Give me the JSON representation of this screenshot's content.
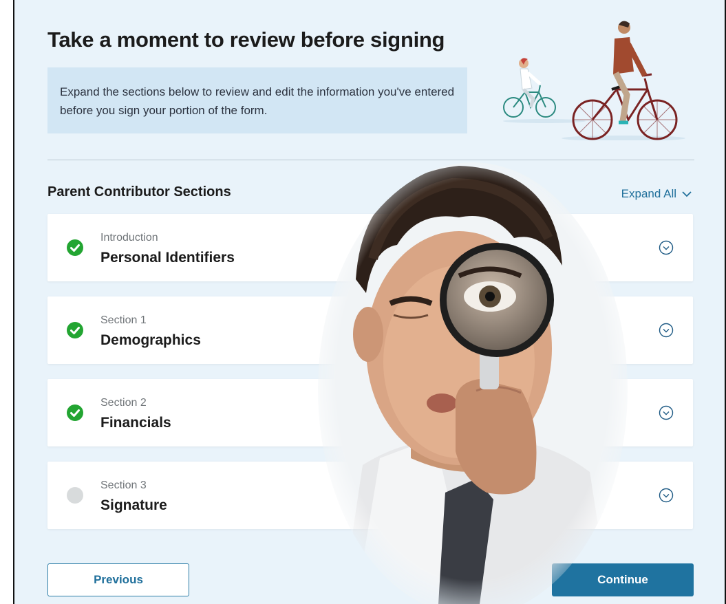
{
  "page": {
    "title": "Take a moment to review before signing",
    "info": "Expand the sections below to review and edit the information you've entered before you sign your portion of the form."
  },
  "sections_panel": {
    "heading": "Parent Contributor Sections",
    "expand_all_label": "Expand All",
    "items": [
      {
        "kicker": "Introduction",
        "name": "Personal Identifiers",
        "status": "complete"
      },
      {
        "kicker": "Section 1",
        "name": "Demographics",
        "status": "complete"
      },
      {
        "kicker": "Section 2",
        "name": "Financials",
        "status": "complete"
      },
      {
        "kicker": "Section 3",
        "name": "Signature",
        "status": "incomplete"
      }
    ]
  },
  "footer": {
    "previous_label": "Previous",
    "continue_label": "Continue"
  },
  "colors": {
    "background": "#e9f3fa",
    "info_box": "#d2e6f4",
    "accent": "#1f73a0",
    "complete": "#23a532",
    "incomplete": "#d8dbdc"
  }
}
